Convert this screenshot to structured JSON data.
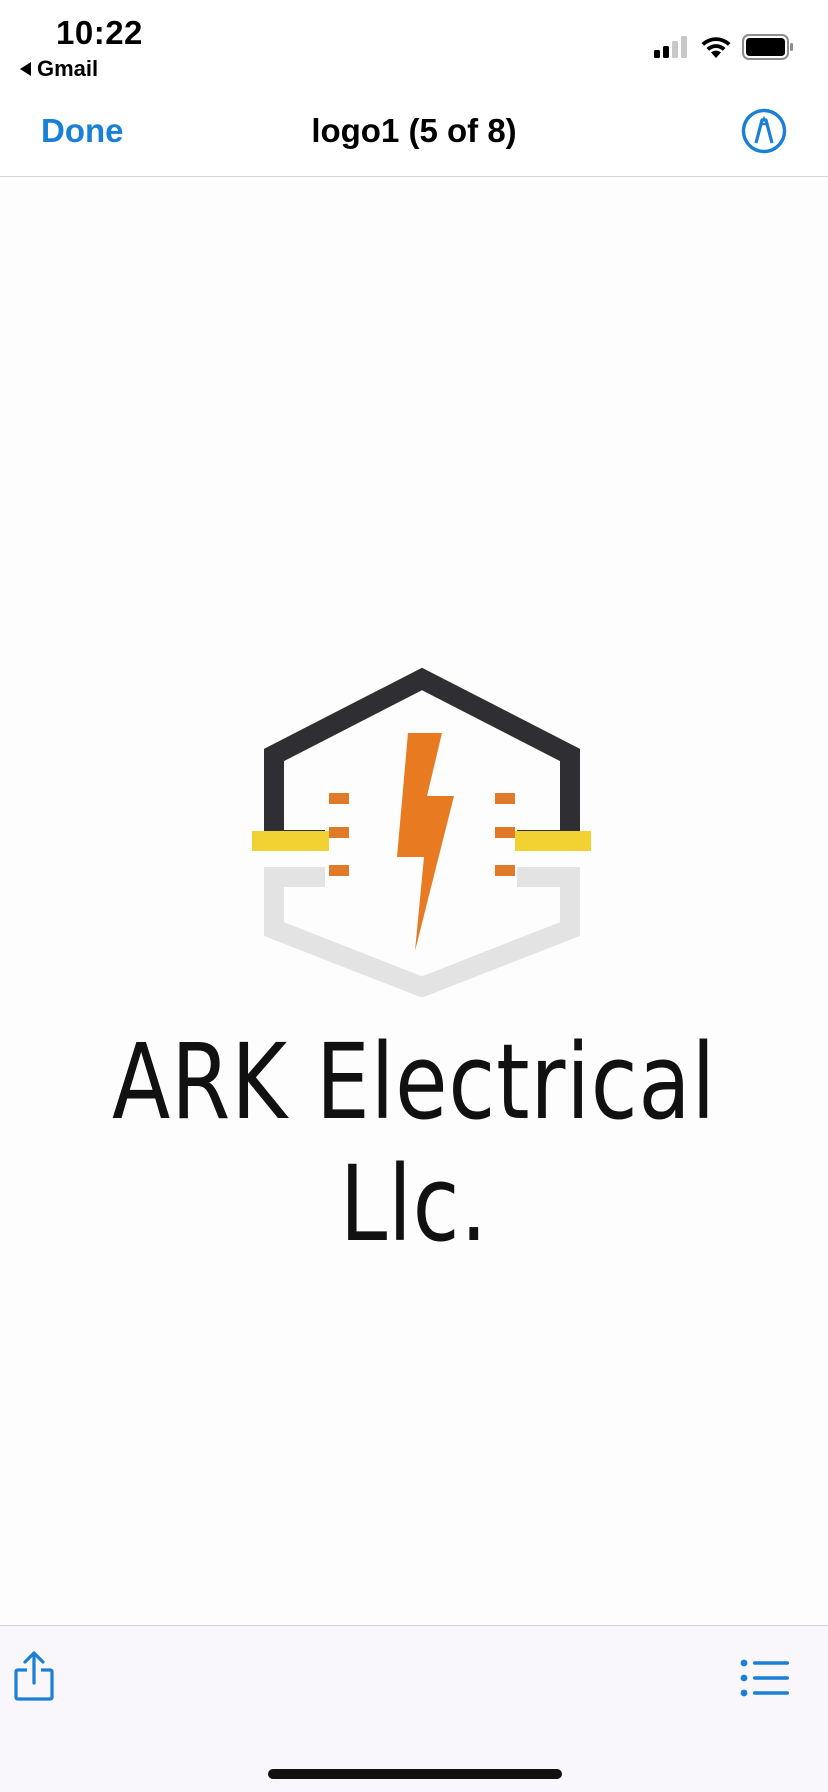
{
  "status_bar": {
    "time": "10:22",
    "back_app": "Gmail",
    "signal_icon": "cellular-signal-icon",
    "wifi_icon": "wifi-icon",
    "battery_icon": "battery-icon"
  },
  "nav": {
    "done_label": "Done",
    "title": "logo1 (5 of 8)",
    "markup_icon": "markup-pen-icon"
  },
  "document": {
    "logo_icon": "ark-electrical-logo-mark",
    "logo_text": "ARK Electrical Llc."
  },
  "toolbar": {
    "share_icon": "share-icon",
    "list_icon": "list-icon"
  },
  "colors": {
    "accent": "#1a7fd6",
    "bolt": "#e87a22",
    "wire_dark": "#2b2b2e",
    "wire_yellow": "#f2d233",
    "wire_light": "#e2e2e2"
  }
}
